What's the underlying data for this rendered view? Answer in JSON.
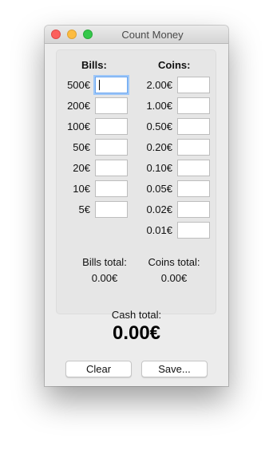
{
  "window": {
    "title": "Count Money"
  },
  "bills": {
    "heading": "Bills:",
    "rows": [
      {
        "label": "500€",
        "value": ""
      },
      {
        "label": "200€",
        "value": ""
      },
      {
        "label": "100€",
        "value": ""
      },
      {
        "label": "50€",
        "value": ""
      },
      {
        "label": "20€",
        "value": ""
      },
      {
        "label": "10€",
        "value": ""
      },
      {
        "label": "5€",
        "value": ""
      }
    ],
    "total_label": "Bills total:",
    "total_value": "0.00€"
  },
  "coins": {
    "heading": "Coins:",
    "rows": [
      {
        "label": "2.00€",
        "value": ""
      },
      {
        "label": "1.00€",
        "value": ""
      },
      {
        "label": "0.50€",
        "value": ""
      },
      {
        "label": "0.20€",
        "value": ""
      },
      {
        "label": "0.10€",
        "value": ""
      },
      {
        "label": "0.05€",
        "value": ""
      },
      {
        "label": "0.02€",
        "value": ""
      },
      {
        "label": "0.01€",
        "value": ""
      }
    ],
    "total_label": "Coins total:",
    "total_value": "0.00€"
  },
  "cash": {
    "label": "Cash total:",
    "value": "0.00€"
  },
  "buttons": {
    "clear": "Clear",
    "save": "Save..."
  },
  "colors": {
    "focus_ring": "#9ec7f8",
    "close": "#fc605c",
    "minimize": "#fdbc40",
    "zoom": "#34c84a"
  }
}
